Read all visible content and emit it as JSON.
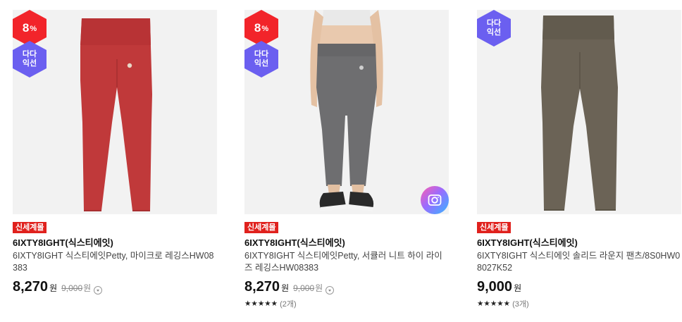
{
  "products": [
    {
      "discount_value": "8",
      "discount_unit": "%",
      "dada_line1": "다다",
      "dada_line2": "익선",
      "tag": "신세계몰",
      "brand": "6IXTY8IGHT(식스티에잇)",
      "name": "6IXTY8IGHT 식스티에잇Petty, 마이크로 레깅스HW08383",
      "price": "8,270",
      "price_unit": "원",
      "original_price": "9,000",
      "original_unit": "원",
      "colors": {
        "garment": "#c0393a",
        "background": "#f2f2f2"
      }
    },
    {
      "discount_value": "8",
      "discount_unit": "%",
      "dada_line1": "다다",
      "dada_line2": "익선",
      "tag": "신세계몰",
      "brand": "6IXTY8IGHT(식스티에잇)",
      "name": "6IXTY8IGHT 식스티에잇Petty, 서큘러 니트 하이 라이즈 레깅스HW08383",
      "price": "8,270",
      "price_unit": "원",
      "original_price": "9,000",
      "original_unit": "원",
      "stars": "★★★★★",
      "review_count": "(2개)",
      "colors": {
        "garment": "#6e6e70",
        "background": "#f2f2f2"
      }
    },
    {
      "dada_line1": "다다",
      "dada_line2": "익선",
      "tag": "신세계몰",
      "brand": "6IXTY8IGHT(식스티에잇)",
      "name": "6IXTY8IGHT 식스티에잇 솔리드 라운지 팬츠/8S0HW08027K52",
      "price": "9,000",
      "price_unit": "원",
      "stars": "★★★★★",
      "review_count": "(3개)",
      "colors": {
        "garment": "#6b6356",
        "background": "#f2f2f2"
      }
    }
  ],
  "icons": {
    "camera_search": "camera-search-icon",
    "price_info": "chevron-down-icon"
  },
  "colors": {
    "discount_badge": "#f2242a",
    "dada_badge": "#6b5ff0",
    "tag": "#e0211d"
  }
}
